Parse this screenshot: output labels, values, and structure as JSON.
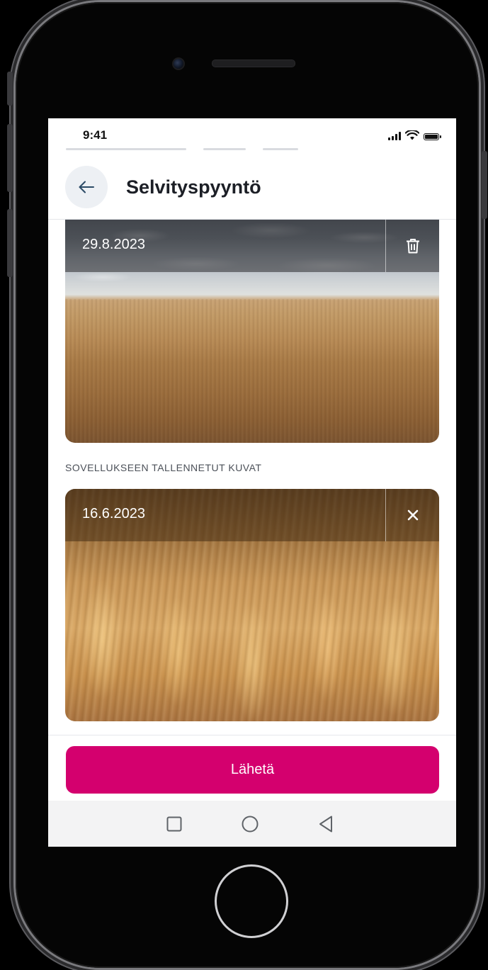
{
  "status_bar": {
    "time": "9:41",
    "icons": [
      "signal-icon",
      "wifi-icon",
      "battery-icon"
    ]
  },
  "header": {
    "title": "Selvityspyyntö",
    "back_icon": "arrow-left-icon"
  },
  "photos": [
    {
      "date": "29.8.2023",
      "action_icon": "trash-icon"
    },
    {
      "date": "16.6.2023",
      "action_icon": "close-icon"
    }
  ],
  "section": {
    "saved_photos_label": "SOVELLUKSEEN TALLENNETUT KUVAT"
  },
  "footer": {
    "send_label": "Lähetä"
  },
  "nav": {
    "icons": [
      "square-recents-icon",
      "circle-home-icon",
      "triangle-back-icon"
    ]
  },
  "colors": {
    "accent": "#d4006e",
    "back_button_bg": "#edf0f4",
    "title": "#1c1f26",
    "back_arrow": "#2b4a66"
  }
}
